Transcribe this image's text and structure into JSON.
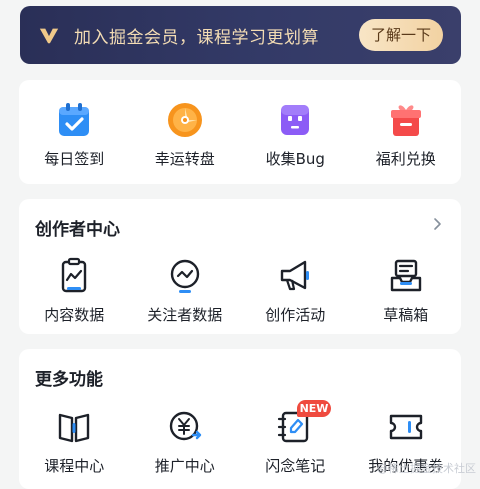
{
  "vip_banner": {
    "text": "加入掘金会员，课程学习更划算",
    "button_label": "了解一下",
    "icon": "vip-v-icon"
  },
  "quick_actions": [
    {
      "label": "每日签到",
      "icon": "calendar-check-icon",
      "color": "#2d8cf0"
    },
    {
      "label": "幸运转盘",
      "icon": "lucky-wheel-icon",
      "color": "#f7931e"
    },
    {
      "label": "收集Bug",
      "icon": "bug-monster-icon",
      "color": "#8a5cf5"
    },
    {
      "label": "福利兑换",
      "icon": "gift-icon",
      "color": "#f04a4a"
    }
  ],
  "creator_center": {
    "title": "创作者中心",
    "items": [
      {
        "label": "内容数据",
        "icon": "content-data-icon"
      },
      {
        "label": "关注者数据",
        "icon": "follower-data-icon"
      },
      {
        "label": "创作活动",
        "icon": "megaphone-icon"
      },
      {
        "label": "草稿箱",
        "icon": "draft-box-icon"
      }
    ]
  },
  "more_features": {
    "title": "更多功能",
    "items": [
      {
        "label": "课程中心",
        "icon": "book-icon"
      },
      {
        "label": "推广中心",
        "icon": "promotion-yen-icon"
      },
      {
        "label": "闪念笔记",
        "icon": "notes-icon"
      },
      {
        "label": "我的优惠券",
        "icon": "coupon-icon"
      }
    ],
    "badge": "NEW"
  },
  "watermark": "@稀土掘金技术社区"
}
